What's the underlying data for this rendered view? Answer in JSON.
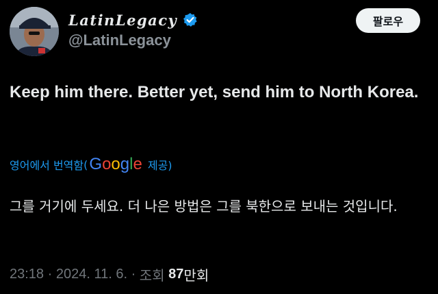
{
  "author": {
    "display_name": "LatinLegacy",
    "handle": "@LatinLegacy",
    "verified": true,
    "avatar_icon": "profile-photo"
  },
  "follow_button": {
    "label": "팔로우"
  },
  "tweet": {
    "text": "Keep him there. Better yet, send him to North Korea."
  },
  "translation": {
    "label": "영어에서 번역함",
    "provider_letters": [
      "G",
      "o",
      "o",
      "g",
      "l",
      "e"
    ],
    "provided_label": "제공)",
    "text": "그를 거기에 두세요. 더 나은 방법은 그를 북한으로 보내는 것입니다."
  },
  "meta": {
    "time": "23:18",
    "date": "2024. 11. 6.",
    "views_label": "조회",
    "views_count": "87",
    "views_unit": "만회"
  },
  "colors": {
    "background": "#000000",
    "text": "#e7e9ea",
    "secondary": "#71767b",
    "link_blue": "#1d9bf0",
    "verified_blue": "#1d9bf0"
  }
}
